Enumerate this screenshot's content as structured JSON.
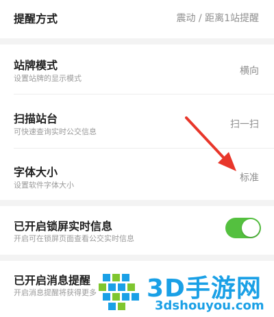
{
  "settings": [
    {
      "title": "提醒方式",
      "subtitle": "",
      "value": "震动 / 距离1站提醒"
    },
    {
      "title": "站牌模式",
      "subtitle": "设置站牌的显示模式",
      "value": "横向"
    },
    {
      "title": "扫描站台",
      "subtitle": "可快速查询实时公交信息",
      "value": "扫一扫"
    },
    {
      "title": "字体大小",
      "subtitle": "设置软件字体大小",
      "value": "标准"
    },
    {
      "title": "已开启锁屏实时信息",
      "subtitle": "开启可在锁屏页面查看公交实时信息",
      "toggle_on": true
    },
    {
      "title": "已开启消息提醒",
      "subtitle": "开启消息提醒将获得更多",
      "toggle_on": true
    }
  ],
  "watermark": {
    "text_big": "3D手游网",
    "text_small": "3dshouyou.com",
    "icon": "3d-logo-icon"
  },
  "colors": {
    "toggle_on": "#54c03f",
    "arrow": "#e8362a",
    "watermark": "#1aa0e6"
  }
}
